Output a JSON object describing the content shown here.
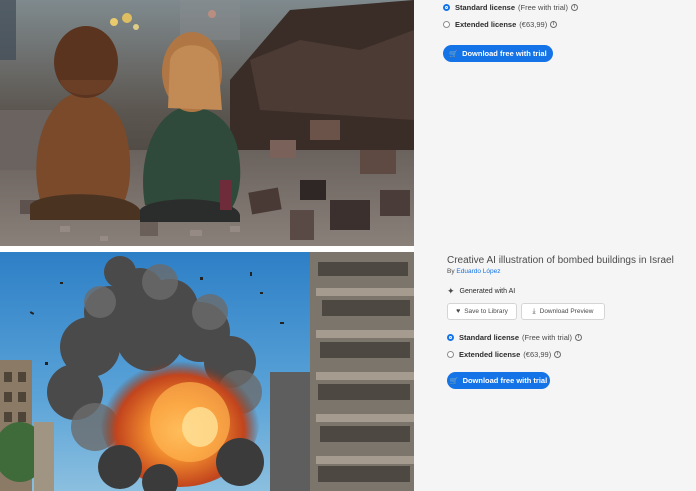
{
  "item1": {
    "license_standard": {
      "name": "Standard license",
      "note": "(Free with trial)",
      "selected": true
    },
    "license_extended": {
      "name": "Extended license",
      "note": "(€63,99)",
      "selected": false
    },
    "download_label": "Download free with trial"
  },
  "item2": {
    "title": "Creative AI illustration of bombed buildings in Israel",
    "by_prefix": "By",
    "author": "Eduardo López",
    "generated_label": "Generated with AI",
    "save_label": "Save to Library",
    "preview_label": "Download Preview",
    "license_standard": {
      "name": "Standard license",
      "note": "(Free with trial)",
      "selected": true
    },
    "license_extended": {
      "name": "Extended license",
      "note": "(€63,99)",
      "selected": false
    },
    "download_label": "Download free with trial"
  },
  "icons": {
    "info": "i",
    "cart": "🛒",
    "heart": "♥",
    "download": "⤓",
    "generated": "✦"
  },
  "colors": {
    "accent": "#1473e6",
    "panel_bg": "#f5f5f5"
  }
}
